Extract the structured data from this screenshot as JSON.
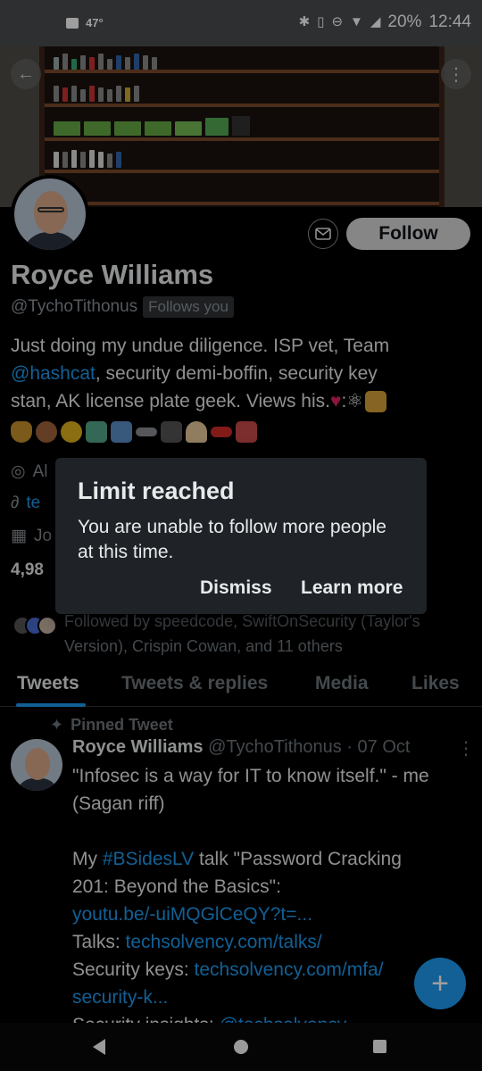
{
  "status_bar": {
    "temperature": "47°",
    "battery": "20%",
    "time": "12:44"
  },
  "profile": {
    "name": "Royce Williams",
    "handle": "@TychoTithonus",
    "follows_you": "Follows you",
    "follow_label": "Follow",
    "bio_line1": "Just doing my undue diligence. ISP vet, Team",
    "bio_link": "@hashcat",
    "bio_line2": ", security demi-boffin, security key",
    "bio_line3": "stan, AK license plate geek. Views his.",
    "bio_suffix": ":⚛",
    "location_partial": "Al",
    "link_partial": "te",
    "joined_partial": "Jo",
    "counts_partial": "4,98",
    "followed_by": "Followed by speedcode, SwiftOnSecurity (Taylor's Version), Crispin Cowan, and 11 others"
  },
  "tabs": [
    "Tweets",
    "Tweets & replies",
    "Media",
    "Likes"
  ],
  "tweet": {
    "pinned_label": "Pinned Tweet",
    "author": "Royce Williams",
    "handle_date": "@TychoTithonus · 07 Oct",
    "more": "⋮",
    "l1": "\"Infosec is a way for IT to know itself.\" - me",
    "l2": "(Sagan riff)",
    "l3a": "My ",
    "l3link": "#BSidesLV",
    "l3b": " talk \"Password Cracking",
    "l4": "201: Beyond the Basics\":",
    "l5link": "youtu.be/-uiMQGlCeQY?t=...",
    "l6a": "Talks: ",
    "l6link": "techsolvency.com/talks/",
    "l7a": "Security keys: ",
    "l7link": "techsolvency.com/mfa/",
    "l8link": "security-k...",
    "l9a": "Security insights: ",
    "l9link": "@techsolvency"
  },
  "dialog": {
    "title": "Limit reached",
    "message": "You are unable to follow more people at this time.",
    "dismiss": "Dismiss",
    "learn_more": "Learn more"
  },
  "colors": {
    "accent": "#1d9bf0",
    "background": "#000000",
    "dialog_bg": "#1f2327"
  }
}
